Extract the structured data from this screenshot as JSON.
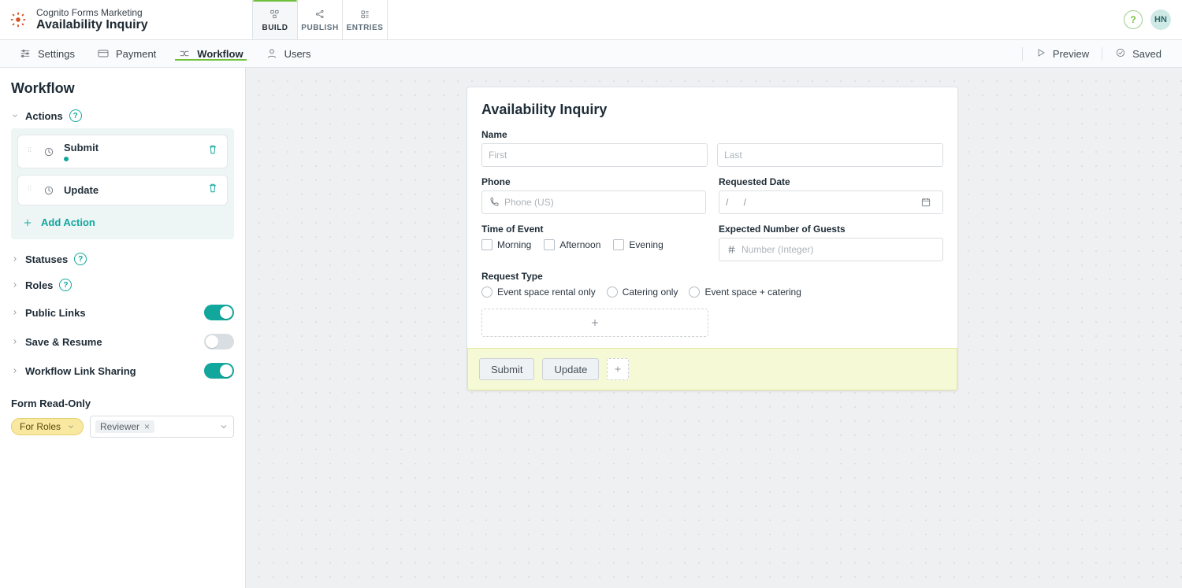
{
  "header": {
    "org": "Cognito Forms Marketing",
    "formName": "Availability Inquiry",
    "tabs": {
      "build": "BUILD",
      "publish": "PUBLISH",
      "entries": "ENTRIES"
    },
    "userInitials": "HN"
  },
  "subnav": {
    "settings": "Settings",
    "payment": "Payment",
    "workflow": "Workflow",
    "users": "Users",
    "preview": "Preview",
    "saved": "Saved"
  },
  "sidebar": {
    "title": "Workflow",
    "actions": {
      "label": "Actions",
      "items": [
        {
          "title": "Submit"
        },
        {
          "title": "Update"
        }
      ],
      "addAction": "Add Action"
    },
    "statuses": "Statuses",
    "roles": "Roles",
    "publicLinks": "Public Links",
    "saveResume": "Save & Resume",
    "workflowLinkSharing": "Workflow Link Sharing",
    "toggles": {
      "publicLinks": true,
      "saveResume": false,
      "workflowLinkSharing": true
    },
    "formReadOnly": {
      "label": "Form Read-Only",
      "chipLabel": "For Roles",
      "roleTag": "Reviewer"
    }
  },
  "form": {
    "title": "Availability Inquiry",
    "name": {
      "label": "Name",
      "firstPlaceholder": "First",
      "lastPlaceholder": "Last"
    },
    "phone": {
      "label": "Phone",
      "placeholder": "Phone (US)"
    },
    "requestedDate": {
      "label": "Requested Date"
    },
    "timeOfEvent": {
      "label": "Time of Event",
      "morning": "Morning",
      "afternoon": "Afternoon",
      "evening": "Evening"
    },
    "guests": {
      "label": "Expected Number of Guests",
      "placeholder": "Number (Integer)"
    },
    "requestType": {
      "label": "Request Type",
      "opt1": "Event space rental only",
      "opt2": "Catering only",
      "opt3": "Event space + catering"
    },
    "actionsBar": {
      "submit": "Submit",
      "update": "Update"
    }
  }
}
